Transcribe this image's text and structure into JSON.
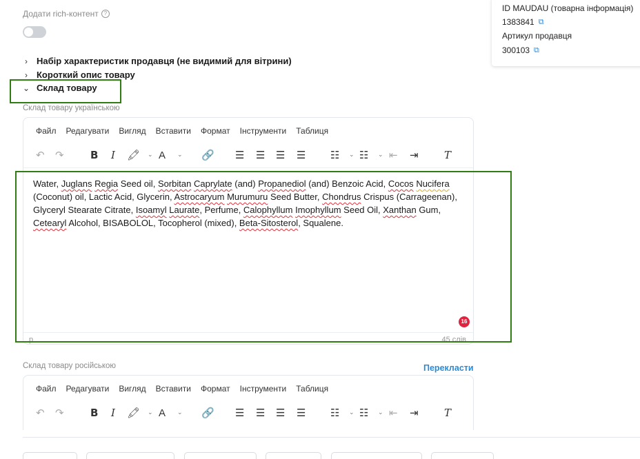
{
  "rich": {
    "label": "Додати rich-контент",
    "help_icon": "?"
  },
  "info": {
    "id_label": "ID MAUDAU (товарна інформація)",
    "id_value": "1383841",
    "seller_article_label": "Артикул продавця",
    "seller_article_value": "300103",
    "copy_icon": "⧉"
  },
  "sections": {
    "seller_features": "Набір характеристик продавця (не видимий для вітрини)",
    "short_description": "Короткий опис товару",
    "composition": "Склад товару",
    "chevron_collapsed": "›",
    "chevron_expanded": "⌄"
  },
  "uk_editor": {
    "label": "Склад товару українською",
    "menu": [
      "Файл",
      "Редагувати",
      "Вигляд",
      "Вставити",
      "Формат",
      "Інструменти",
      "Таблиця"
    ],
    "content": [
      {
        "t": "Water, "
      },
      {
        "t": "Juglans",
        "s": "sp"
      },
      {
        "t": " "
      },
      {
        "t": "Regia",
        "s": "sp"
      },
      {
        "t": " Seed oil, "
      },
      {
        "t": "Sorbitan",
        "s": "sp"
      },
      {
        "t": " "
      },
      {
        "t": "Caprylate",
        "s": "sp"
      },
      {
        "t": " (and) "
      },
      {
        "t": "Propanediol",
        "s": "sp"
      },
      {
        "t": " (and) Benzoic Acid, "
      },
      {
        "t": "Cocos",
        "s": "sp"
      },
      {
        "t": " "
      },
      {
        "t": "Nucifera",
        "s": "gr"
      },
      {
        "t": " (Coconut) oil, Lactic Acid, Glycerin, "
      },
      {
        "t": "Astrocaryum",
        "s": "sp"
      },
      {
        "t": " "
      },
      {
        "t": "Murumuru",
        "s": "sp"
      },
      {
        "t": " Seed Butter, "
      },
      {
        "t": "Chondrus",
        "s": "sp"
      },
      {
        "t": " Crispus (Carrageenan), Glyceryl Stearate Citrate, "
      },
      {
        "t": "Isoamyl",
        "s": "sp"
      },
      {
        "t": " "
      },
      {
        "t": "Laurate",
        "s": "sp"
      },
      {
        "t": ", Perfume, "
      },
      {
        "t": "Calophyllum",
        "s": "sp"
      },
      {
        "t": " "
      },
      {
        "t": "Imophyllum",
        "s": "sp"
      },
      {
        "t": " Seed Oil, "
      },
      {
        "t": "Xanthan",
        "s": "sp"
      },
      {
        "t": " Gum, "
      },
      {
        "t": "Cetearyl",
        "s": "sp"
      },
      {
        "t": " Alcohol, BISABOLOL, Tocopherol (mixed), "
      },
      {
        "t": "Beta-Sitosterol",
        "s": "sp"
      },
      {
        "t": ", Squalene."
      }
    ],
    "badge": "16",
    "path": "p",
    "words": "45 слів"
  },
  "ru_editor": {
    "label": "Склад товару російською",
    "translate": "Перекласти",
    "menu": [
      "Файл",
      "Редагувати",
      "Вигляд",
      "Вставити",
      "Формат",
      "Інструменти",
      "Таблиця"
    ]
  },
  "toolbar_icons": {
    "undo": "↶",
    "redo": "↷",
    "bold": "B",
    "italic": "I",
    "highlight": "🖍",
    "font_color": "A",
    "dropdown": "⌄",
    "link": "🔗",
    "align_left": "☰",
    "align_center": "☰",
    "align_right": "☰",
    "justify": "☰",
    "bullet_list": "☷",
    "numbered_list": "☷",
    "outdent": "⇤",
    "indent": "⇥",
    "clear_format": "T"
  }
}
